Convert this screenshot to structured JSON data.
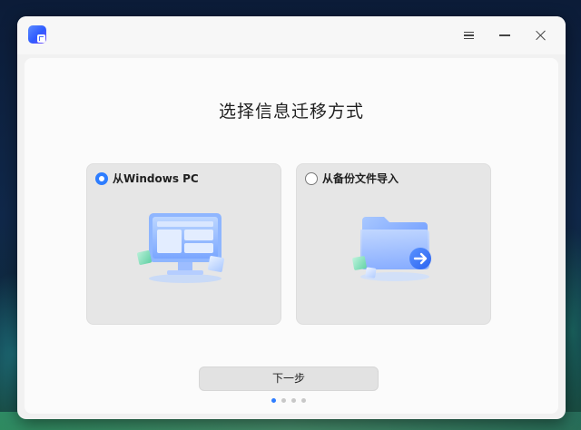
{
  "window": {
    "app_icon": "data-migration-app-icon",
    "controls": {
      "menu_icon": "hamburger-menu-icon",
      "minimize_icon": "minimize-icon",
      "close_icon": "close-icon"
    }
  },
  "main": {
    "title": "选择信息迁移方式",
    "options": [
      {
        "label": "从Windows PC",
        "selected": true,
        "icon": "windows-pc-monitor-icon"
      },
      {
        "label": "从备份文件导入",
        "selected": false,
        "icon": "backup-folder-import-icon"
      }
    ],
    "next_button": "下一步",
    "pagination": {
      "total": 4,
      "current": 1
    }
  },
  "colors": {
    "accent": "#2e7dff",
    "card_bg": "#e6e6e6",
    "window_bg": "#f1f1f1"
  }
}
